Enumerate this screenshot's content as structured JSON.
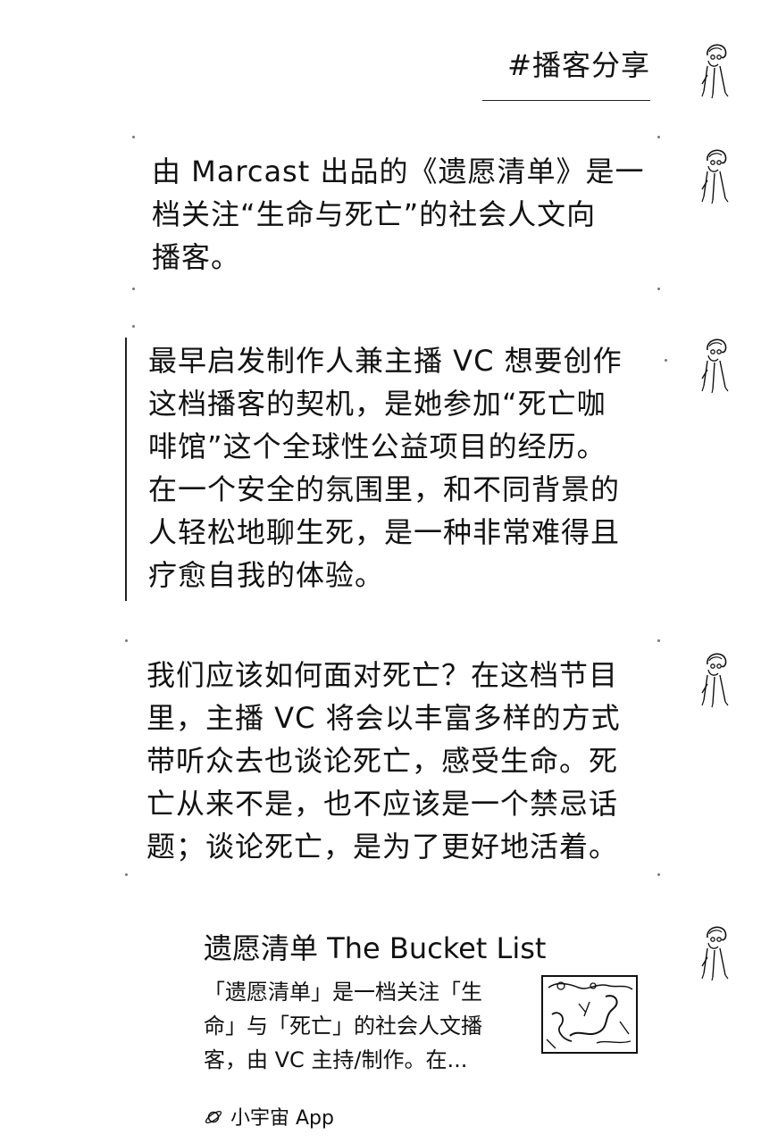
{
  "hashtag": "#播客分享",
  "messages": [
    "由 Marcast 出品的《遗愿清单》是一\n档关注“生命与死亡”的社会人文向\n播客。",
    "最早启发制作人兼主播 VC 想要创作\n这档播客的契机，是她参加“死亡咖\n啡馆”这个全球性公益项目的经历。\n在一个安全的氛围里，和不同背景的\n人轻松地聊生死，是一种非常难得且\n疗愈自我的体验。",
    "我们应该如何面对死亡？在这档节目\n里，主播 VC 将会以丰富多样的方式\n带听众去也谈论死亡，感受生命。死\n亡从来不是，也不应该是一个禁忌话\n题；谈论死亡，是为了更好地活着。"
  ],
  "card": {
    "title": "遗愿清单 The Bucket List",
    "description": "「遗愿清单」是一档关注「生\n命」与「死亡」的社会人文播\n客，由 VC 主持/制作。在...",
    "source": "小宇宙 App",
    "source_icon": "planet-icon",
    "thumbnail_icon": "podcast-cover-icon"
  },
  "avatar_icon": "line-drawing-person-avatar-icon"
}
